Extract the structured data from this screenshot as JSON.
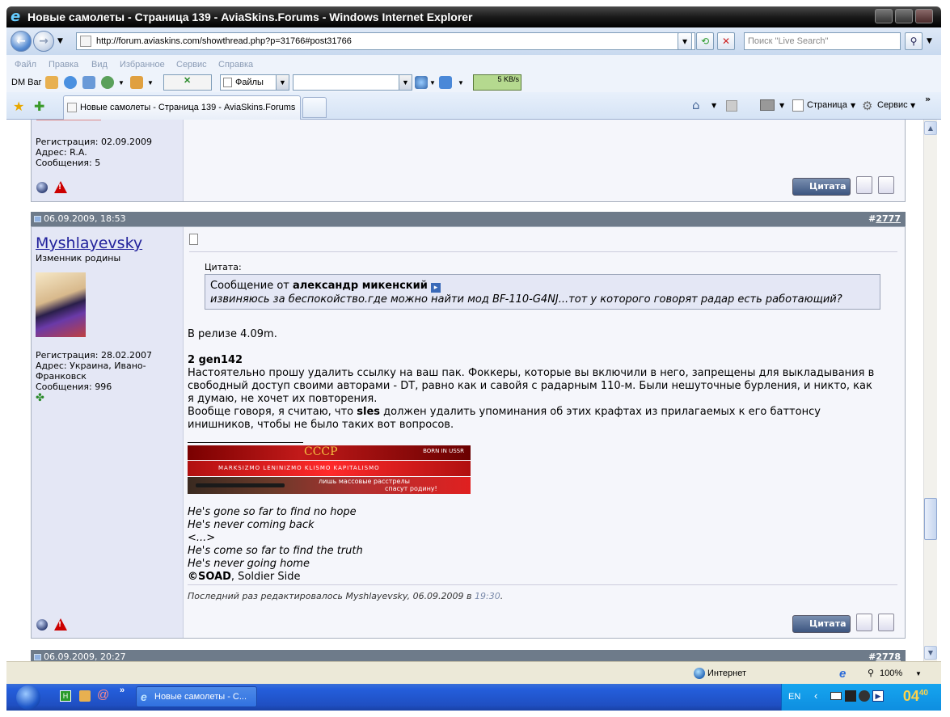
{
  "window": {
    "title": "Новые самолеты - Страница 139 - AviaSkins.Forums - Windows Internet Explorer"
  },
  "addressbar": {
    "url": "http://forum.aviaskins.com/showthread.php?p=31766#post31766",
    "search_placeholder": "Поиск \"Live Search\""
  },
  "menu": {
    "items": [
      "Файл",
      "Правка",
      "Вид",
      "Избранное",
      "Сервис",
      "Справка"
    ]
  },
  "dmbar": {
    "label": "DM Bar",
    "files_label": "Файлы",
    "speed": "5 KB/s"
  },
  "tabs": {
    "active": "Новые самолеты - Страница 139 - AviaSkins.Forums",
    "page_menu": "Страница",
    "tools_menu": "Сервис"
  },
  "post_prev": {
    "registration": "Регистрация: 02.09.2009",
    "address": "Адрес: R.A.",
    "messages": "Сообщения: 5",
    "quote_label": "Цитата"
  },
  "post_main": {
    "date": "06.09.2009, 18:53",
    "number_prefix": "#",
    "number": "2777",
    "username": "Myshlayevsky",
    "user_title": "Изменник родины",
    "registration": "Регистрация: 28.02.2007",
    "address_line1": "Адрес: Украина, Ивано-",
    "address_line2": "Франковск",
    "messages": "Сообщения: 996",
    "quote_header": "Цитата:",
    "quote_from_prefix": "Сообщение от ",
    "quote_author": "александр микенский",
    "quote_text": "извиняюсь за беспокойство.где можно найти мод BF-110-G4NJ...тот у которого говорят радар есть работающий?",
    "line_release": "В релизе 4.09m.",
    "to_user": "2 gen142",
    "para1": "Настоятельно прошу удалить ссылку на ваш пак. Фоккеры, которые вы включили в него, запрещены для выкладывания в свободный доступ своими авторами - DT, равно как и савойя с радарным 110-м. Были нешуточные бурления, и никто, как я думаю, не хочет их повторения.",
    "para2_a": "Вообще говоря, я считаю, что ",
    "para2_bold": "sles",
    "para2_b": " должен удалить упоминания об этих крафтах из прилагаемых к его баттонсу инишников, чтобы не было таких вот вопросов.",
    "banner_title": "СССР",
    "banner_born": "BORN IN USSR",
    "banner_line2": "MARKSIZMO LENINIZMO KLISMO KAPITALISMO",
    "banner_line3a": "лишь массовые расстрелы",
    "banner_line3b": "спасут родину!",
    "lyric1": "He's gone so far to find no hope",
    "lyric2": "He's never coming back",
    "lyric3": "<...>",
    "lyric4": "He's come so far to find the truth",
    "lyric5": "He's never going home",
    "credit_bold": "©SOAD",
    "credit_rest": ", Soldier Side",
    "edited_prefix": "Последний раз редактировалось Myshlayevsky, 06.09.2009 в ",
    "edited_time": "19:30",
    "edited_suffix": ".",
    "quote_label": "Цитата"
  },
  "post_next": {
    "date": "06.09.2009, 20:27",
    "number_prefix": "#",
    "number": "2778"
  },
  "statusbar": {
    "zone": "Интернет",
    "zoom": "100%"
  },
  "taskbar": {
    "task": "Новые самолеты - С...",
    "lang": "EN",
    "clock_h": "04",
    "clock_m": "40"
  }
}
